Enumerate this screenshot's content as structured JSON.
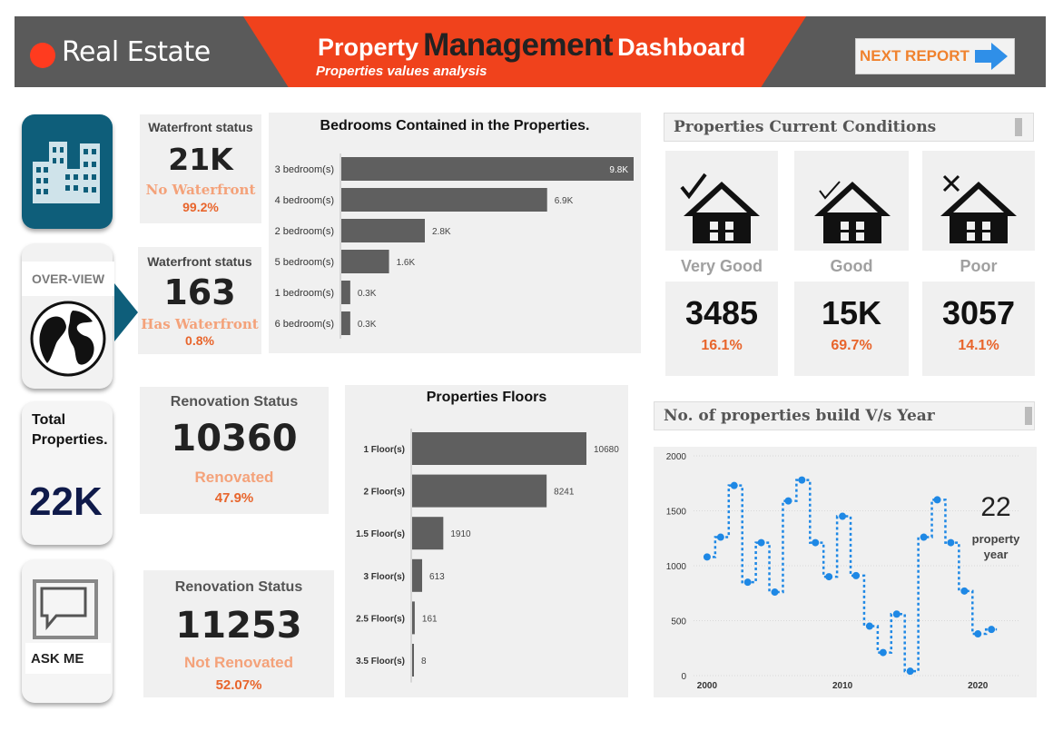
{
  "header": {
    "brand": "Real Estate",
    "title_part1": "Property",
    "title_part2": "Management",
    "title_part3": "Dashboard",
    "subtitle": "Properties values analysis",
    "next_button": "NEXT REPORT",
    "colors": {
      "bar": "#5a5a5a",
      "accent": "#f0421c",
      "brand_dot": "#ff3b1f",
      "next_text": "#f0822e",
      "arrow": "#2f8fe8"
    }
  },
  "nav": {
    "overview_label": "OVER-VIEW",
    "total_label_line1": "Total",
    "total_label_line2": "Properties.",
    "total_value": "22K",
    "ask_label": "ASK ME",
    "icons": [
      "buildings-icon",
      "globe-icon",
      "speech-bubble-icon"
    ],
    "colors": {
      "primary": "#0e5e7a",
      "total_value": "#0f1a4a"
    }
  },
  "waterfront": [
    {
      "label": "Waterfront status",
      "value": "21K",
      "status": "No Waterfront",
      "percent": "99.2%"
    },
    {
      "label": "Waterfront status",
      "value": "163",
      "status": "Has Waterfront",
      "percent": "0.8%"
    }
  ],
  "renovation": [
    {
      "label": "Renovation Status",
      "value": "10360",
      "status": "Renovated",
      "percent": "47.9%"
    },
    {
      "label": "Renovation Status",
      "value": "11253",
      "status": "Not Renovated",
      "percent": "52.07%"
    }
  ],
  "conditions": {
    "title": "Properties Current Conditions",
    "cards": [
      {
        "name": "Very Good",
        "value": "3485",
        "percent": "16.1%",
        "icon": "house-double-check-icon"
      },
      {
        "name": "Good",
        "value": "15K",
        "percent": "69.7%",
        "icon": "house-check-icon"
      },
      {
        "name": "Poor",
        "value": "3057",
        "percent": "14.1%",
        "icon": "house-cross-icon"
      }
    ]
  },
  "year_panel": {
    "title": "No. of properties build V/s Year",
    "kpi_value": "22",
    "kpi_label_line1": "property",
    "kpi_label_line2": "year"
  },
  "chart_data": [
    {
      "type": "bar",
      "orientation": "horizontal",
      "title": "Bedrooms Contained in the Properties.",
      "categories": [
        "3 bedroom(s)",
        "4 bedroom(s)",
        "2 bedroom(s)",
        "5 bedroom(s)",
        "1 bedroom(s)",
        "6 bedroom(s)"
      ],
      "values": [
        9800,
        6900,
        2800,
        1600,
        300,
        300
      ],
      "labels": [
        "9.8K",
        "6.9K",
        "2.8K",
        "1.6K",
        "0.3K",
        "0.3K"
      ],
      "xlim": [
        0,
        9800
      ],
      "color": "#5f5f5f"
    },
    {
      "type": "bar",
      "orientation": "horizontal",
      "title": "Properties Floors",
      "categories": [
        "1 Floor(s)",
        "2 Floor(s)",
        "1.5 Floor(s)",
        "3 Floor(s)",
        "2.5 Floor(s)",
        "3.5 Floor(s)"
      ],
      "values": [
        10680,
        8241,
        1910,
        613,
        161,
        8
      ],
      "labels": [
        "10680",
        "8241",
        "1910",
        "613",
        "161",
        "8"
      ],
      "xlim": [
        0,
        10680
      ],
      "color": "#5f5f5f"
    },
    {
      "type": "line",
      "step": true,
      "dotted": true,
      "x": [
        2000,
        2001,
        2002,
        2003,
        2004,
        2005,
        2006,
        2007,
        2008,
        2009,
        2010,
        2011,
        2012,
        2013,
        2014,
        2015,
        2016,
        2017,
        2018,
        2019,
        2020,
        2021
      ],
      "y": [
        1080,
        1260,
        1730,
        850,
        1210,
        760,
        1590,
        1780,
        1210,
        900,
        1450,
        910,
        450,
        210,
        560,
        40,
        1260,
        1600,
        1210,
        770,
        380,
        420
      ],
      "xticks": [
        "2000",
        "2010",
        "2020"
      ],
      "yticks": [
        "0",
        "500",
        "1000",
        "1500",
        "2000"
      ],
      "xlim": [
        1999,
        2023
      ],
      "ylim": [
        0,
        2000
      ],
      "grid": true,
      "color": "#1e88e5"
    }
  ]
}
